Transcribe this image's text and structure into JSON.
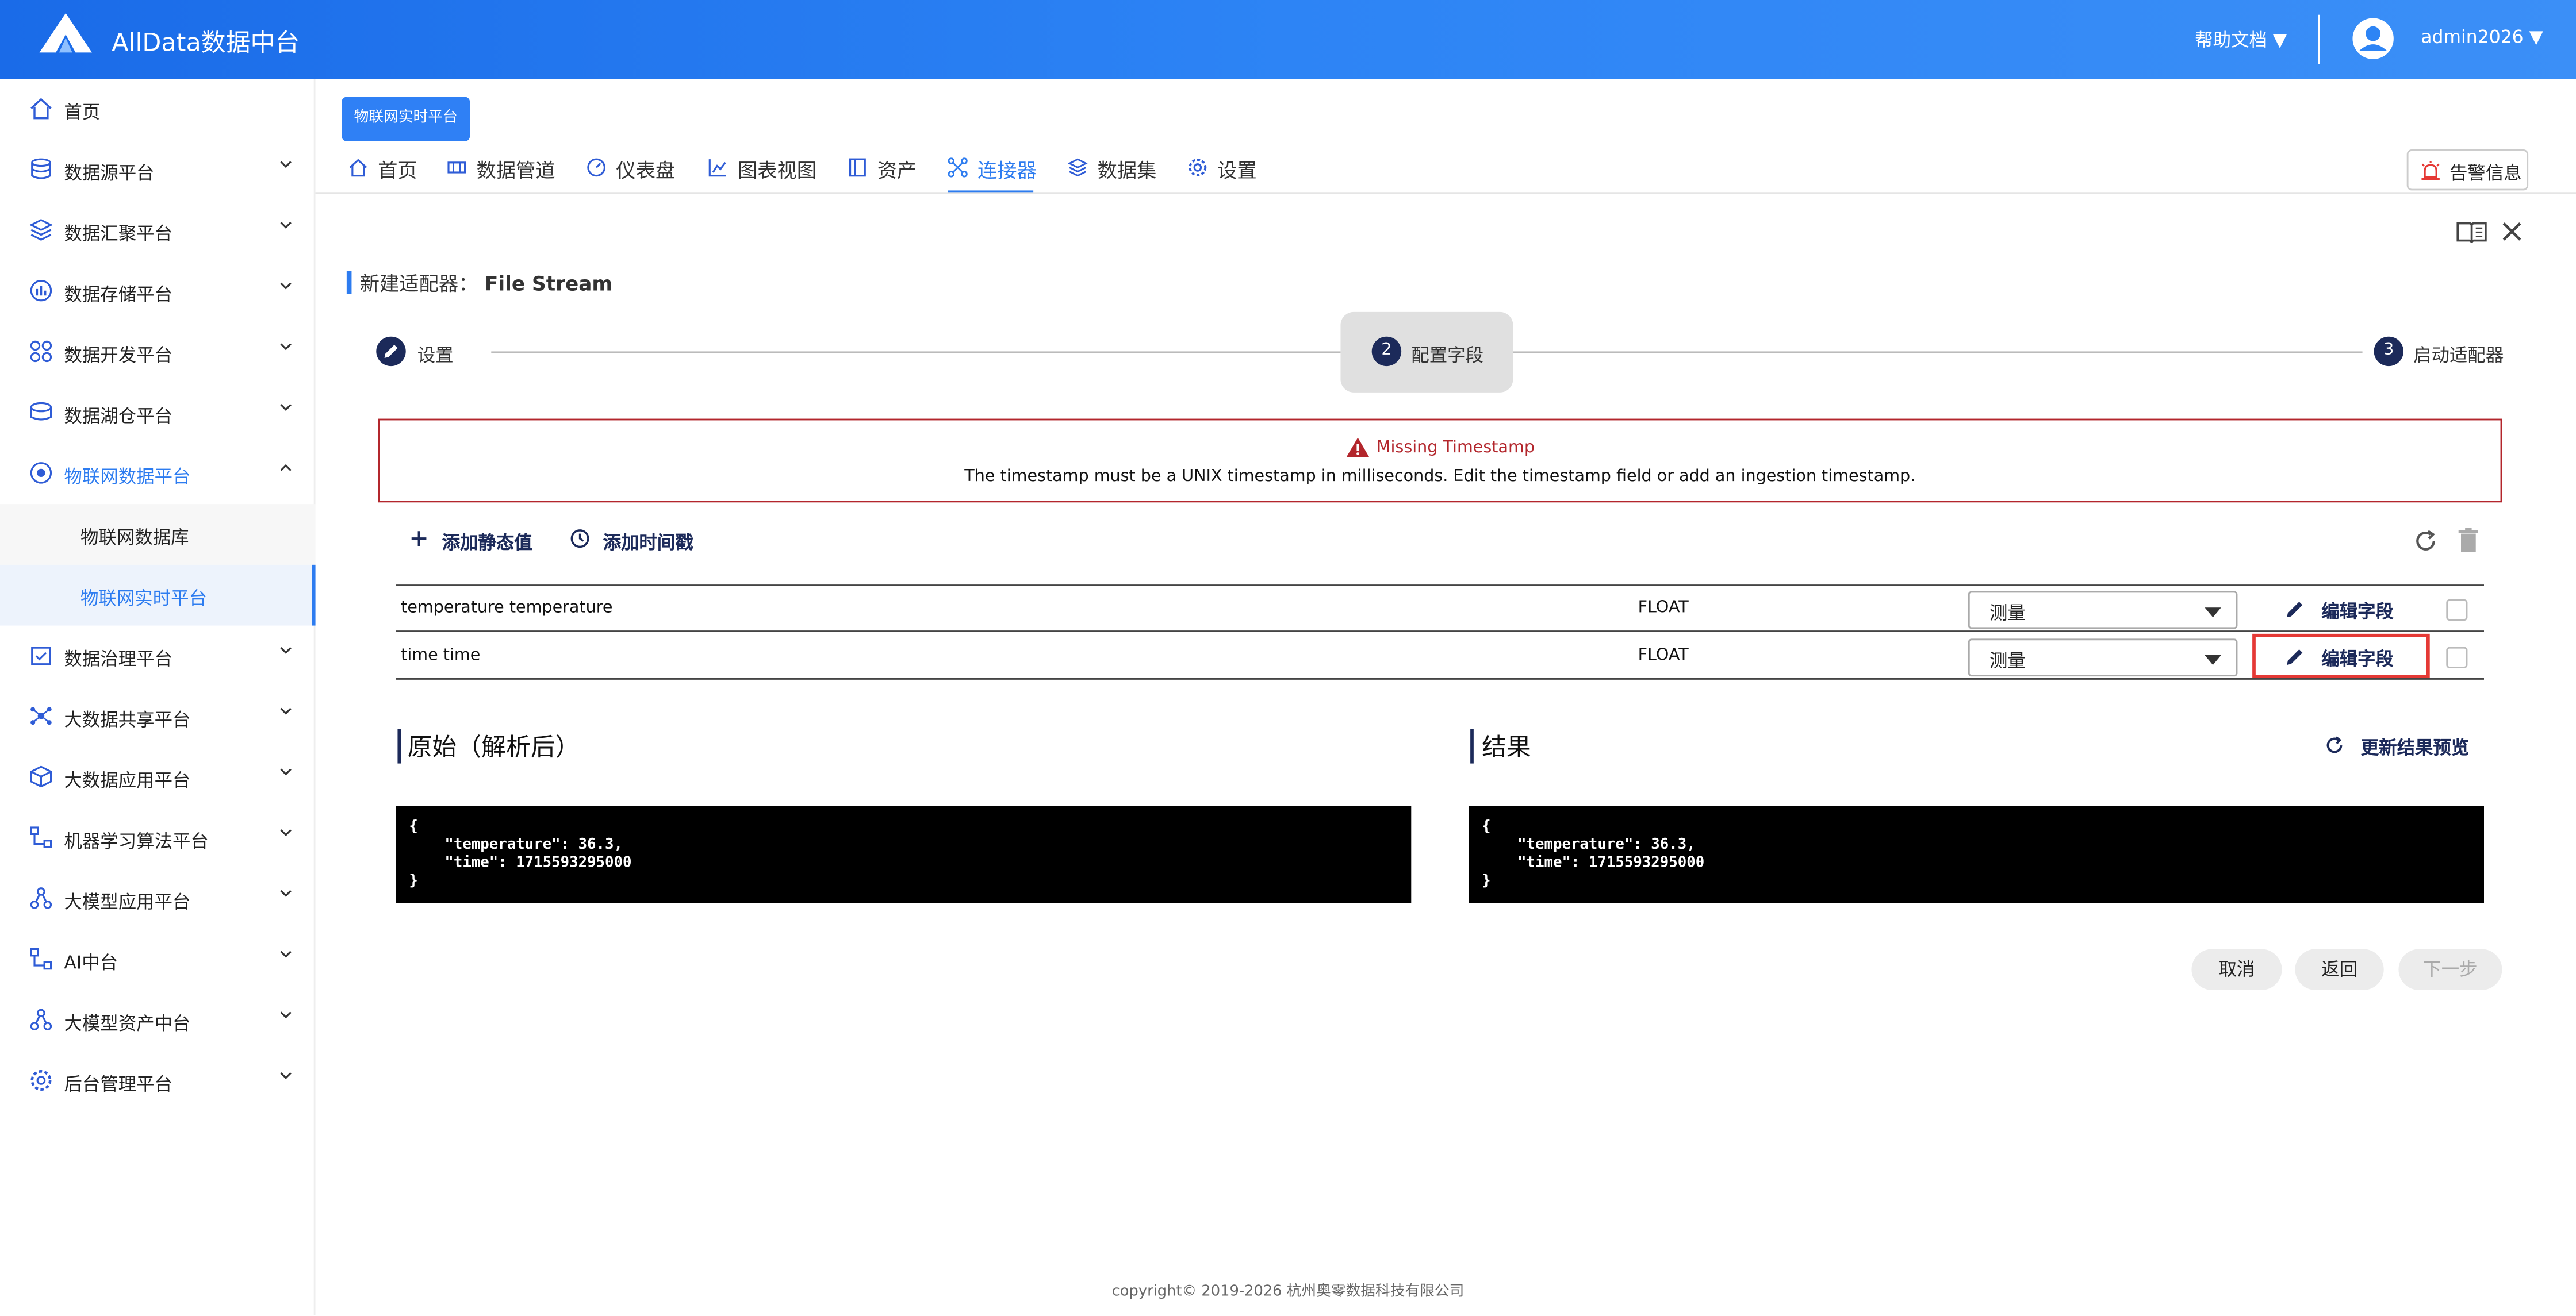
{
  "app": {
    "title": "AllData数据中台",
    "help_label": "帮助文档 ▼",
    "user_label": "admin2026 ▼"
  },
  "sidebar": {
    "items": [
      {
        "label": "首页"
      },
      {
        "label": "数据源平台"
      },
      {
        "label": "数据汇聚平台"
      },
      {
        "label": "数据存储平台"
      },
      {
        "label": "数据开发平台"
      },
      {
        "label": "数据湖仓平台"
      },
      {
        "label": "物联网数据平台"
      },
      {
        "label": "物联网数据库"
      },
      {
        "label": "物联网实时平台"
      },
      {
        "label": "数据治理平台"
      },
      {
        "label": "大数据共享平台"
      },
      {
        "label": "大数据应用平台"
      },
      {
        "label": "机器学习算法平台"
      },
      {
        "label": "大模型应用平台"
      },
      {
        "label": "AI中台"
      },
      {
        "label": "大模型资产中台"
      },
      {
        "label": "后台管理平台"
      }
    ]
  },
  "breadcrumb_tag": "物联网实时平台",
  "tabs": [
    {
      "label": "首页",
      "icon": "home-icon"
    },
    {
      "label": "数据管道",
      "icon": "pipeline-icon"
    },
    {
      "label": "仪表盘",
      "icon": "dashboard-icon"
    },
    {
      "label": "图表视图",
      "icon": "chart-icon"
    },
    {
      "label": "资产",
      "icon": "asset-icon"
    },
    {
      "label": "连接器",
      "icon": "connector-icon",
      "active": true
    },
    {
      "label": "数据集",
      "icon": "dataset-icon"
    },
    {
      "label": "设置",
      "icon": "settings-icon"
    }
  ],
  "alarm_label": "告警信息",
  "title": {
    "prefix": "新建适配器：",
    "name": "File Stream"
  },
  "steps": [
    {
      "num": "",
      "label": "设置"
    },
    {
      "num": "2",
      "label": "配置字段"
    },
    {
      "num": "3",
      "label": "启动适配器"
    }
  ],
  "alert": {
    "title": "Missing Timestamp",
    "message": "The timestamp must be a UNIX timestamp in milliseconds. Edit the timestamp field or add an ingestion timestamp."
  },
  "actions": {
    "add_static": "添加静态值",
    "add_timestamp": "添加时间戳"
  },
  "fields": [
    {
      "name": "temperature temperature",
      "type": "FLOAT",
      "role": "测量",
      "edit": "编辑字段"
    },
    {
      "name": "time time",
      "type": "FLOAT",
      "role": "测量",
      "edit": "编辑字段"
    }
  ],
  "raw": {
    "title": "原始（解析后）",
    "lines": [
      "{",
      "    \"temperature\": 36.3,",
      "    \"time\": 1715593295000",
      "}"
    ]
  },
  "result": {
    "title": "结果",
    "update_label": "更新结果预览",
    "lines": [
      "{",
      "    \"temperature\": 36.3,",
      "    \"time\": 1715593295000",
      "}"
    ]
  },
  "buttons": {
    "cancel": "取消",
    "back": "返回",
    "next": "下一步"
  },
  "footer": "copyright© 2019-2026 杭州奥零数据科技有限公司",
  "colors": {
    "header": "#2d84f5",
    "accent": "#2d7cf0",
    "navy": "#1c2a5a",
    "alert": "#b3262c"
  }
}
